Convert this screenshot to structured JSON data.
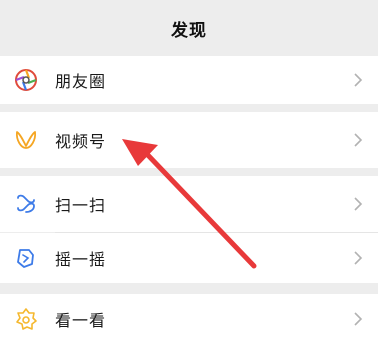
{
  "header": {
    "title": "发现"
  },
  "menu": {
    "items": [
      {
        "label": "朋友圈",
        "icon": "moments-icon"
      },
      {
        "label": "视频号",
        "icon": "channels-icon"
      },
      {
        "label": "扫一扫",
        "icon": "scan-icon"
      },
      {
        "label": "摇一摇",
        "icon": "shake-icon"
      },
      {
        "label": "看一看",
        "icon": "top-stories-icon"
      }
    ]
  },
  "colors": {
    "background": "#ededed",
    "row_background": "#ffffff",
    "annotation_arrow": "#e8393a",
    "channels_accent": "#f5a623",
    "scan_accent": "#3d7be8",
    "shake_accent": "#3d7be8",
    "top_stories_accent": "#f5b82e"
  }
}
